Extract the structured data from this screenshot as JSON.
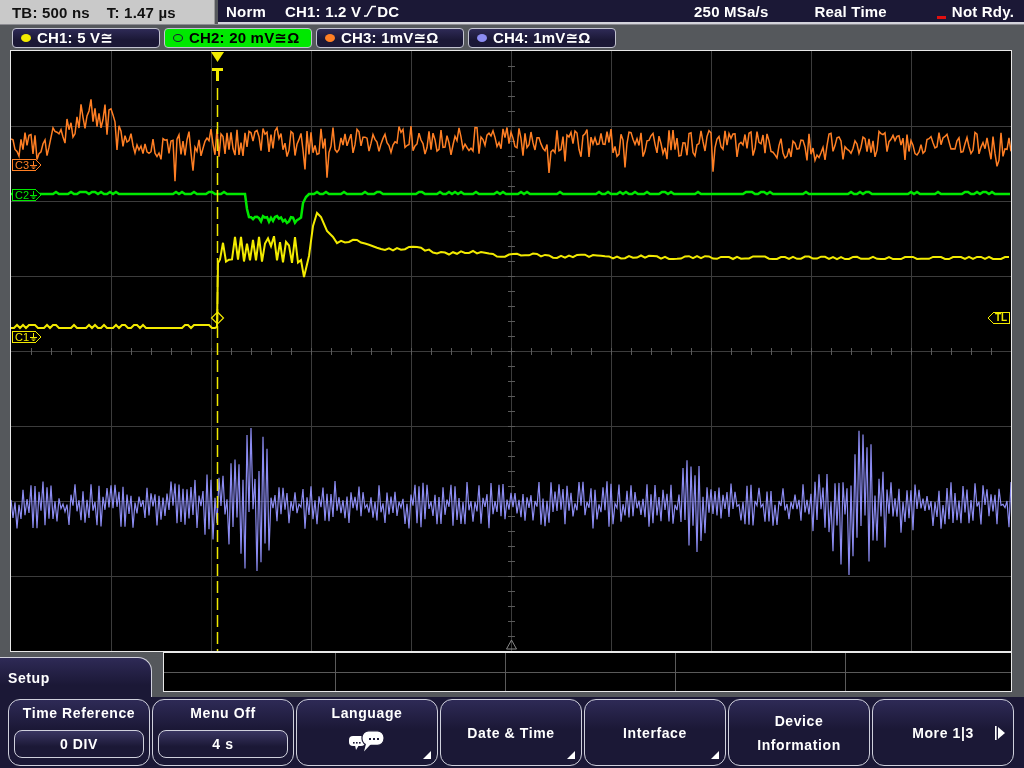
{
  "status_bar": {
    "timebase": "TB: 500 ns",
    "trigger_time": "T: 1.47 µs",
    "trigger_mode": "Norm",
    "trigger_source": "CH1: 1.2 V",
    "coupling": "DC",
    "sample_rate": "250 MSa/s",
    "acquisition_mode": "Real Time",
    "state": "Not Rdy."
  },
  "channels": [
    {
      "label": "CH1: 5 V≅",
      "color": "#f2ea00",
      "selected": false
    },
    {
      "label": "CH2: 20 mV≅Ω",
      "color": "#00e800",
      "selected": true
    },
    {
      "label": "CH3: 1mV≅Ω",
      "color": "#ff7f24",
      "selected": false
    },
    {
      "label": "CH4: 1mV≅Ω",
      "color": "#8c8cf2",
      "selected": false
    }
  ],
  "display": {
    "markers": [
      {
        "label": "C3",
        "color": "#ff7f24"
      },
      {
        "label": "C2",
        "color": "#00e800"
      },
      {
        "label": "C1",
        "color": "#f2ea00"
      }
    ],
    "trigger_level_marker": "TL"
  },
  "menu": {
    "title": "Setup",
    "softkeys": [
      {
        "kind": "value",
        "label": "Time Reference",
        "value": "0 DIV",
        "submenu": false
      },
      {
        "kind": "value",
        "label": "Menu Off",
        "value": "4 s",
        "submenu": false
      },
      {
        "kind": "icon",
        "label": "Language",
        "submenu": true
      },
      {
        "kind": "plain",
        "label": "Date & Time",
        "submenu": true
      },
      {
        "kind": "plain",
        "label": "Interface",
        "submenu": true
      },
      {
        "kind": "plain",
        "label": "Device Information",
        "submenu": false
      },
      {
        "kind": "next",
        "label": "More 1|3",
        "submenu": false
      }
    ]
  }
}
